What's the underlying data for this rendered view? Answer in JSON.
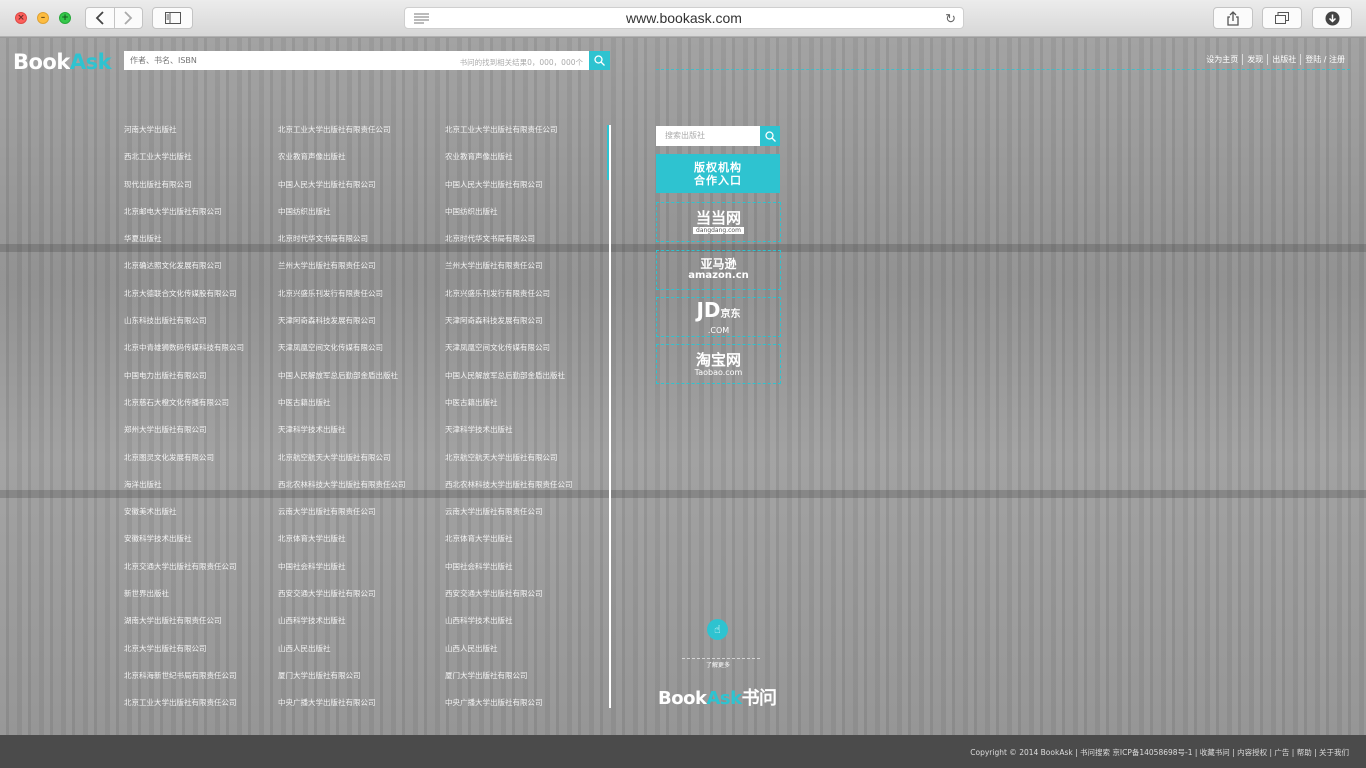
{
  "browser": {
    "url": "www.bookask.com",
    "back_icon": "chevron-left-icon",
    "forward_icon": "chevron-right-icon",
    "sidebar_icon": "sidebar-icon",
    "reload_icon": "reload-icon",
    "share_icon": "share-icon",
    "tabs_icon": "tabs-icon",
    "download_icon": "download-icon"
  },
  "header": {
    "logo_book": "Book",
    "logo_ask": "Ask",
    "search_placeholder": "作者、书名、ISBN",
    "search_hint": "书问的找到相关结果0，000，000个",
    "nav": [
      "设为主页",
      "发现",
      "出版社",
      "登陆 / 注册"
    ]
  },
  "publishers": {
    "col1": [
      "河南大学出版社",
      "西北工业大学出版社",
      "现代出版社有限公司",
      "北京邮电大学出版社有限公司",
      "华夏出版社",
      "北京确达照文化发展有限公司",
      "北京大德联合文化传媒股有限公司",
      "山东科技出版社有限公司",
      "北京中青雄狮数码传媒科技有限公司",
      "中国电力出版社有限公司",
      "北京慈石大橙文化传播有限公司",
      "郑州大学出版社有限公司",
      "北京图灵文化发展有限公司",
      "海洋出版社",
      "安徽美术出版社",
      "安徽科学技术出版社",
      "北京交通大学出版社有限责任公司",
      "新世界出版社",
      "湖南大学出版社有限责任公司",
      "北京大学出版社有限公司",
      "北京科海新世纪书局有限责任公司",
      "北京工业大学出版社有限责任公司"
    ],
    "col2": [
      "北京工业大学出版社有限责任公司",
      "农业教育声像出版社",
      "中国人民大学出版社有限公司",
      "中国纺织出版社",
      "北京时代华文书局有限公司",
      "兰州大学出版社有限责任公司",
      "北京兴盛乐刊发行有限责任公司",
      "天津阿奇森科技发展有限公司",
      "天津凤凰空间文化传媒有限公司",
      "中国人民解放军总后勤部金盾出版社",
      "中医古籍出版社",
      "天津科学技术出版社",
      "北京航空航天大学出版社有限公司",
      "西北农林科技大学出版社有限责任公司",
      "云南大学出版社有限责任公司",
      "北京体育大学出版社",
      "中国社会科学出版社",
      "西安交通大学出版社有限公司",
      "山西科学技术出版社",
      "山西人民出版社",
      "厦门大学出版社有限公司",
      "中央广播大学出版社有限公司"
    ],
    "col3": [
      "北京工业大学出版社有限责任公司",
      "农业教育声像出版社",
      "中国人民大学出版社有限公司",
      "中国纺织出版社",
      "北京时代华文书局有限公司",
      "兰州大学出版社有限责任公司",
      "北京兴盛乐刊发行有限责任公司",
      "天津阿奇森科技发展有限公司",
      "天津凤凰空间文化传媒有限公司",
      "中国人民解放军总后勤部金盾出版社",
      "中医古籍出版社",
      "天津科学技术出版社",
      "北京航空航天大学出版社有限公司",
      "西北农林科技大学出版社有限责任公司",
      "云南大学出版社有限责任公司",
      "北京体育大学出版社",
      "中国社会科学出版社",
      "西安交通大学出版社有限公司",
      "山西科学技术出版社",
      "山西人民出版社",
      "厦门大学出版社有限公司",
      "中央广播大学出版社有限公司"
    ]
  },
  "sidebar": {
    "publisher_search_placeholder": "搜索出版社",
    "coop_line1": "版权机构",
    "coop_line2": "合作入口",
    "dangdang": "当当网",
    "dangdang_sub": "dangdang.com",
    "amazon_cn": "亚马逊",
    "amazon": "amazon.cn",
    "jd": "JD",
    "jd_cn": "京东",
    "jd_com": ".COM",
    "taobao": "淘宝网",
    "taobao_sub": "Taobao.com",
    "more_label": "了解更多",
    "footer_logo_book": "Book",
    "footer_logo_ask": "Ask",
    "footer_logo_cn": "书问"
  },
  "footer": {
    "text": "Copyright © 2014 BookAsk  |  书问搜索 京ICP备14058698号-1  |  收藏书问  |  内容授权  |  广告  |  帮助  |  关于我们"
  },
  "colors": {
    "accent": "#2ec3d0",
    "footer": "#4b4b4b"
  }
}
